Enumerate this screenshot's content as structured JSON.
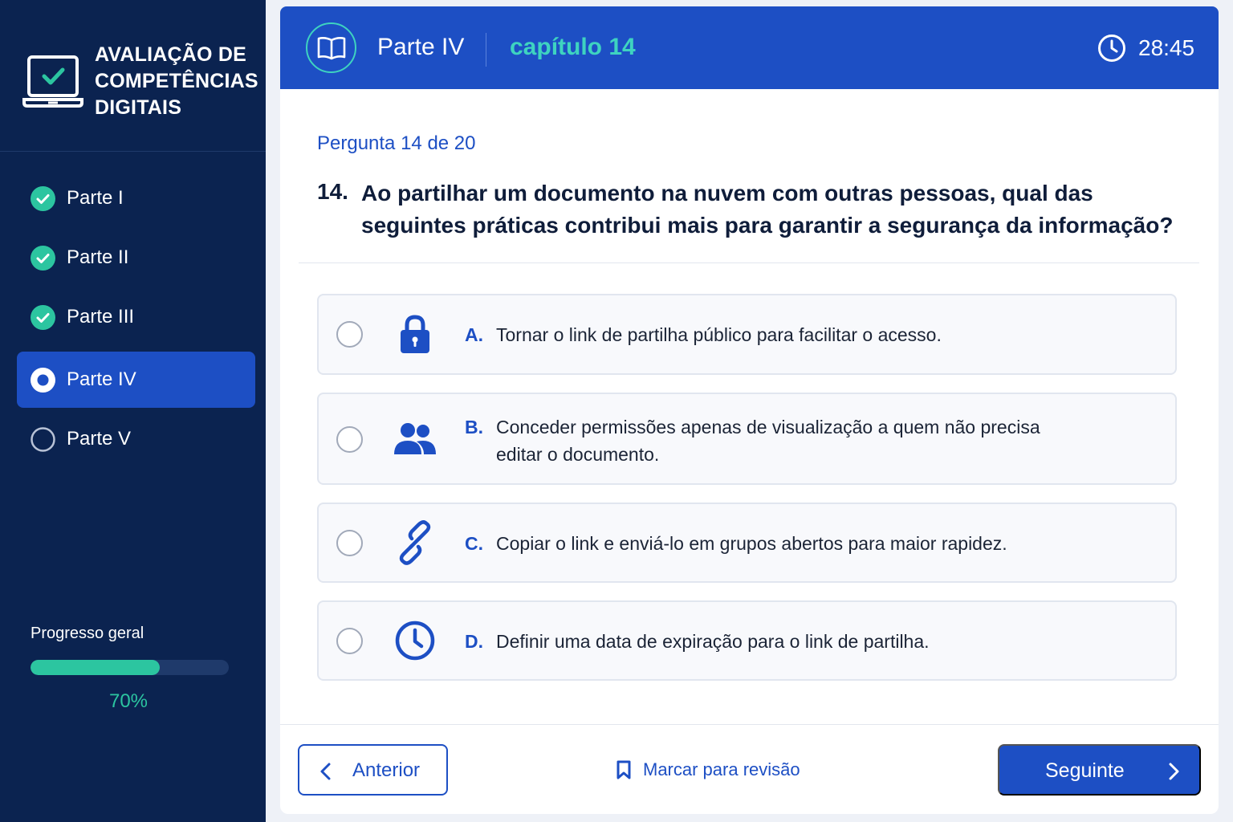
{
  "sidebar": {
    "brand_lines": [
      "AVALIAÇÃO DE",
      "COMPETÊNCIAS",
      "DIGITAIS"
    ],
    "items": [
      {
        "label": "Parte I",
        "status": "completed"
      },
      {
        "label": "Parte II",
        "status": "completed"
      },
      {
        "label": "Parte III",
        "status": "completed"
      },
      {
        "label": "Parte IV",
        "status": "current"
      },
      {
        "label": "Parte V",
        "status": "pending"
      }
    ],
    "progress": {
      "label": "Progresso geral",
      "value_text": "70%",
      "fraction": 0.65
    }
  },
  "header": {
    "part": "Parte IV",
    "chapter": "capítulo 14",
    "timer": "28:45",
    "icons": {
      "part": "book-icon",
      "timer": "clock-icon"
    }
  },
  "question": {
    "counter": "Pergunta 14 de 20",
    "number": "14.",
    "text_lines": [
      "Ao partilhar um documento na nuvem com outras pessoas, qual das",
      "seguintes práticas contribui mais para garantir a segurança da informação?"
    ]
  },
  "options": [
    {
      "letter": "A.",
      "icon": "lock-icon",
      "lines": [
        "Tornar o link de partilha público para facilitar o acesso."
      ]
    },
    {
      "letter": "B.",
      "icon": "users-icon",
      "lines": [
        "Conceder permissões apenas de visualização a quem não precisa",
        "editar o documento."
      ]
    },
    {
      "letter": "C.",
      "icon": "link-icon",
      "lines": [
        "Copiar o link e enviá-lo em grupos abertos para maior rapidez."
      ]
    },
    {
      "letter": "D.",
      "icon": "clock-icon",
      "lines": [
        "Definir uma data de expiração para o link de partilha."
      ]
    }
  ],
  "footer": {
    "prev_label": "Anterior",
    "mark_label": "Marcar para revisão",
    "next_label": "Seguinte"
  },
  "colors": {
    "sidebar_bg": "#0b2350",
    "primary": "#1d4fc4",
    "accent_teal": "#2cc5a0",
    "chapter_teal": "#3ed3c0"
  }
}
